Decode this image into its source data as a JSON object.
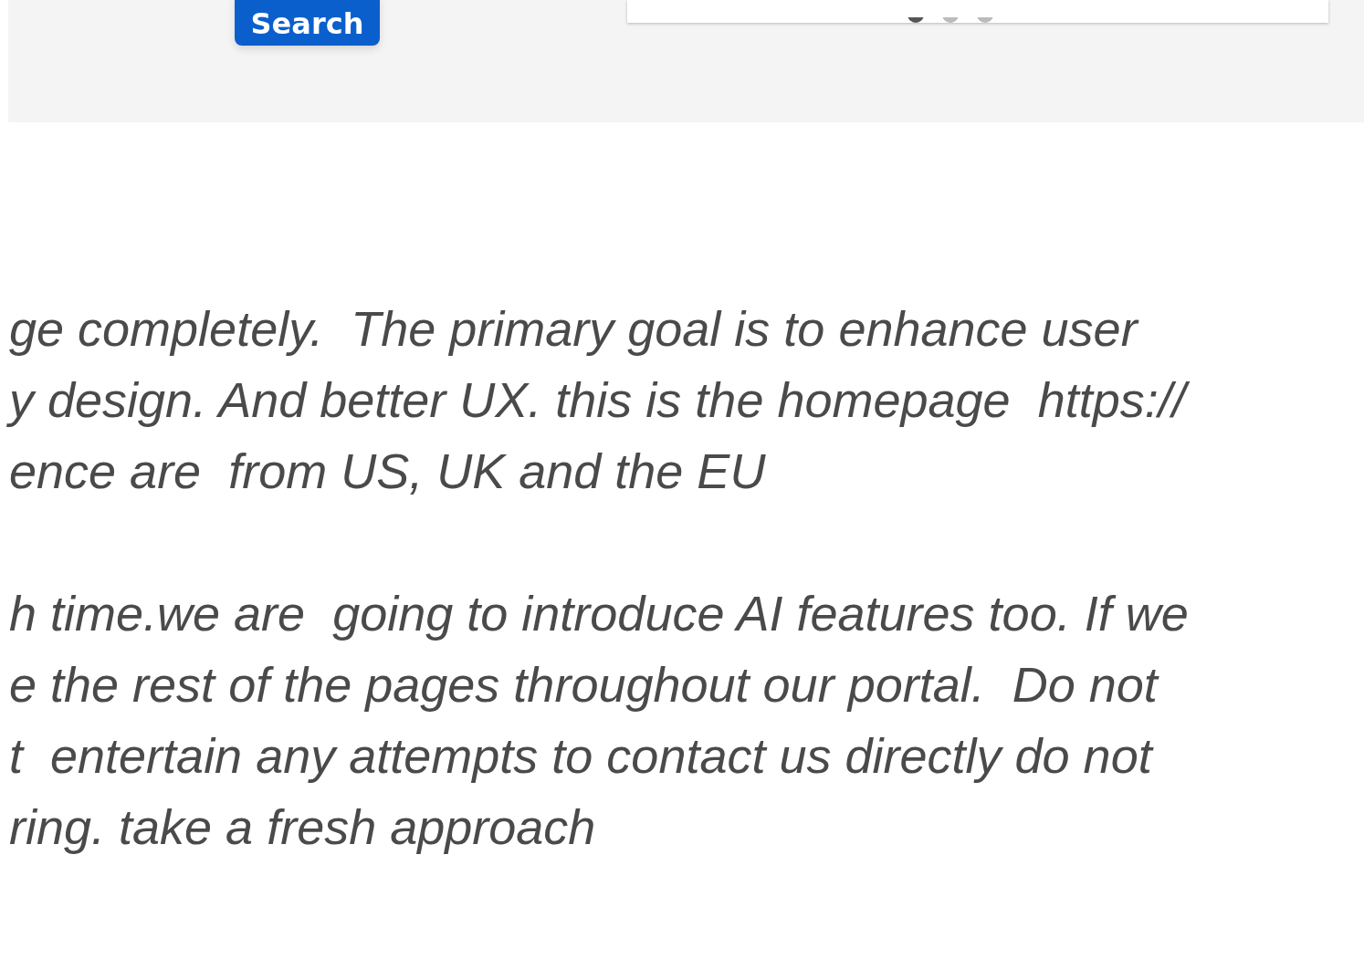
{
  "search_button": {
    "label": "Search"
  },
  "carousel": {
    "dots": [
      {
        "selected": true
      },
      {
        "selected": false
      },
      {
        "selected": false
      }
    ]
  },
  "paragraphs": [
    {
      "lines": [
        "ge completely.  The primary goal is to enhance user",
        "y design. And better UX. this is the homepage  https://",
        "ence are  from US, UK and the EU"
      ]
    },
    {
      "lines": [
        "h time.we are  going to introduce AI features too. If we",
        "e the rest of the pages throughout our portal.  Do not",
        "t  entertain any attempts to contact us directly do not",
        "ring. take a fresh approach"
      ]
    }
  ]
}
